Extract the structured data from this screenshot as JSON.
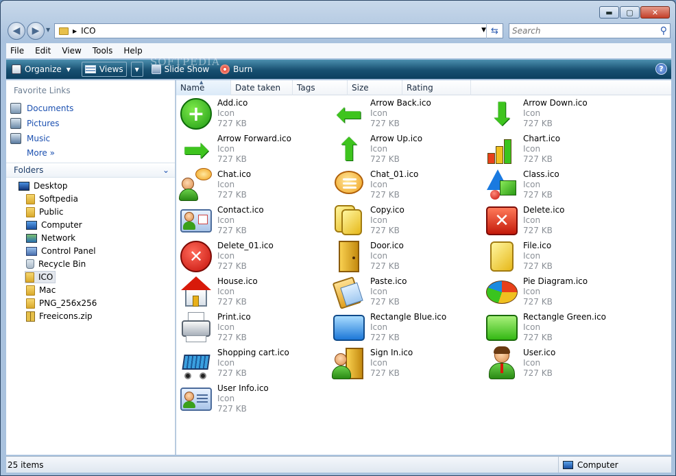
{
  "window": {
    "caption_buttons": {
      "minimize": "▬",
      "maximize": "▢",
      "close": "✕"
    }
  },
  "nav": {
    "back_icon": "◀",
    "forward_icon": "▶",
    "address_crumb": "ICO",
    "search_placeholder": "Search"
  },
  "menu": [
    "File",
    "Edit",
    "View",
    "Tools",
    "Help"
  ],
  "commands": {
    "organize": "Organize",
    "views": "Views",
    "slideshow": "Slide Show",
    "burn": "Burn",
    "help": "?"
  },
  "watermark": "SOFTPEDIA",
  "sidebar": {
    "favorites_title": "Favorite Links",
    "favorites": [
      "Documents",
      "Pictures",
      "Music"
    ],
    "more": "More",
    "folders_title": "Folders",
    "tree": [
      {
        "label": "Desktop",
        "icon": "desktop-icon",
        "level": 0
      },
      {
        "label": "Softpedia",
        "icon": "user-folder-icon",
        "level": 1
      },
      {
        "label": "Public",
        "icon": "folder-icon",
        "level": 1
      },
      {
        "label": "Computer",
        "icon": "computer-icon",
        "level": 1
      },
      {
        "label": "Network",
        "icon": "network-icon",
        "level": 1
      },
      {
        "label": "Control Panel",
        "icon": "control-panel-icon",
        "level": 1
      },
      {
        "label": "Recycle Bin",
        "icon": "recycle-bin-icon",
        "level": 1
      },
      {
        "label": "ICO",
        "icon": "folder-icon",
        "level": 1,
        "selected": true
      },
      {
        "label": "Mac",
        "icon": "folder-icon",
        "level": 1
      },
      {
        "label": "PNG_256x256",
        "icon": "folder-icon",
        "level": 1
      },
      {
        "label": "Freeicons.zip",
        "icon": "zip-icon",
        "level": 1
      }
    ]
  },
  "columns": [
    "Name",
    "Date taken",
    "Tags",
    "Size",
    "Rating"
  ],
  "files": [
    {
      "name": "Add.ico",
      "type": "Icon",
      "size": "727 KB",
      "icon": "add-icon"
    },
    {
      "name": "Arrow Back.ico",
      "type": "Icon",
      "size": "727 KB",
      "icon": "arrow-back-icon"
    },
    {
      "name": "Arrow Down.ico",
      "type": "Icon",
      "size": "727 KB",
      "icon": "arrow-down-icon"
    },
    {
      "name": "Arrow Forward.ico",
      "type": "Icon",
      "size": "727 KB",
      "icon": "arrow-forward-icon"
    },
    {
      "name": "Arrow Up.ico",
      "type": "Icon",
      "size": "727 KB",
      "icon": "arrow-up-icon"
    },
    {
      "name": "Chart.ico",
      "type": "Icon",
      "size": "727 KB",
      "icon": "chart-icon"
    },
    {
      "name": "Chat.ico",
      "type": "Icon",
      "size": "727 KB",
      "icon": "chat-icon"
    },
    {
      "name": "Chat_01.ico",
      "type": "Icon",
      "size": "727 KB",
      "icon": "chat-bubble-icon"
    },
    {
      "name": "Class.ico",
      "type": "Icon",
      "size": "727 KB",
      "icon": "class-icon"
    },
    {
      "name": "Contact.ico",
      "type": "Icon",
      "size": "727 KB",
      "icon": "contact-icon"
    },
    {
      "name": "Copy.ico",
      "type": "Icon",
      "size": "727 KB",
      "icon": "copy-icon"
    },
    {
      "name": "Delete.ico",
      "type": "Icon",
      "size": "727 KB",
      "icon": "delete-icon"
    },
    {
      "name": "Delete_01.ico",
      "type": "Icon",
      "size": "727 KB",
      "icon": "delete-circle-icon"
    },
    {
      "name": "Door.ico",
      "type": "Icon",
      "size": "727 KB",
      "icon": "door-icon"
    },
    {
      "name": "File.ico",
      "type": "Icon",
      "size": "727 KB",
      "icon": "file-icon"
    },
    {
      "name": "House.ico",
      "type": "Icon",
      "size": "727 KB",
      "icon": "house-icon"
    },
    {
      "name": "Paste.ico",
      "type": "Icon",
      "size": "727 KB",
      "icon": "paste-icon"
    },
    {
      "name": "Pie Diagram.ico",
      "type": "Icon",
      "size": "727 KB",
      "icon": "pie-diagram-icon"
    },
    {
      "name": "Print.ico",
      "type": "Icon",
      "size": "727 KB",
      "icon": "print-icon"
    },
    {
      "name": "Rectangle Blue.ico",
      "type": "Icon",
      "size": "727 KB",
      "icon": "rectangle-blue-icon"
    },
    {
      "name": "Rectangle Green.ico",
      "type": "Icon",
      "size": "727 KB",
      "icon": "rectangle-green-icon"
    },
    {
      "name": "Shopping cart.ico",
      "type": "Icon",
      "size": "727 KB",
      "icon": "shopping-cart-icon"
    },
    {
      "name": "Sign In.ico",
      "type": "Icon",
      "size": "727 KB",
      "icon": "sign-in-icon"
    },
    {
      "name": "User.ico",
      "type": "Icon",
      "size": "727 KB",
      "icon": "user-icon"
    },
    {
      "name": "User Info.ico",
      "type": "Icon",
      "size": "727 KB",
      "icon": "user-info-icon"
    }
  ],
  "status": {
    "count": "25 items",
    "zone": "Computer"
  }
}
